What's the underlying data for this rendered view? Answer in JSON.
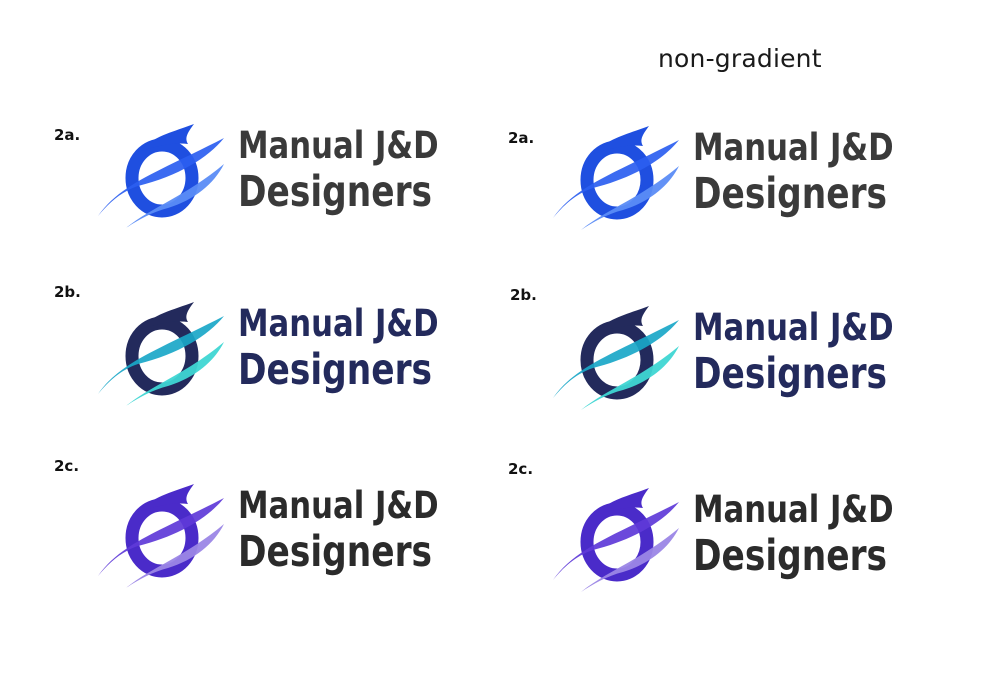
{
  "heading": "non-gradient",
  "logo_text": {
    "line1": "Manual J&D",
    "line2": "Designers"
  },
  "variants": [
    {
      "label": "2a.",
      "ring": "#1f4fe0",
      "swoosh_top": "#2b5ef0",
      "swoosh_bottom": "#5b8cf5",
      "text_color": "#3a3a3a"
    },
    {
      "label": "2b.",
      "ring": "#232a5c",
      "swoosh_top": "#1aa7c8",
      "swoosh_bottom": "#3fd6d3",
      "text_color": "#232a5c"
    },
    {
      "label": "2c.",
      "ring": "#4a2bc9",
      "swoosh_top": "#5e3ad8",
      "swoosh_bottom": "#9b86e6",
      "text_color": "#2b2b2b"
    },
    {
      "label": "2a.",
      "ring": "#1f4fe0",
      "swoosh_top": "#2b5ef0",
      "swoosh_bottom": "#5b8cf5",
      "text_color": "#3a3a3a"
    },
    {
      "label": "2b.",
      "ring": "#232a5c",
      "swoosh_top": "#1aa7c8",
      "swoosh_bottom": "#3fd6d3",
      "text_color": "#232a5c"
    },
    {
      "label": "2c.",
      "ring": "#4a2bc9",
      "swoosh_top": "#5e3ad8",
      "swoosh_bottom": "#9b86e6",
      "text_color": "#2b2b2b"
    }
  ]
}
